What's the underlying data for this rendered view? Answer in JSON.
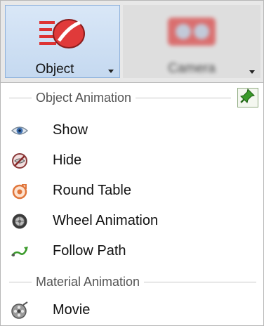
{
  "toolbar": {
    "object_label": "Object",
    "camera_label": "Camera"
  },
  "sections": {
    "object_animation": "Object Animation",
    "material_animation": "Material Animation"
  },
  "items": {
    "show": "Show",
    "hide": "Hide",
    "round_table": "Round Table",
    "wheel_animation": "Wheel Animation",
    "follow_path": "Follow Path",
    "movie": "Movie"
  },
  "icons": {
    "object": "object-disc-icon",
    "camera": "camera-icon",
    "pin": "pin-icon",
    "show": "eye-icon",
    "hide": "hidden-eye-icon",
    "round_table": "rotating-disc-icon",
    "wheel_animation": "wheel-icon",
    "follow_path": "path-arrow-icon",
    "movie": "film-reel-icon"
  },
  "colors": {
    "accent_red": "#e03a3a",
    "selected_blue": "#c5d9f0",
    "pin_green": "#3a9a2a",
    "section_text": "#555555"
  }
}
